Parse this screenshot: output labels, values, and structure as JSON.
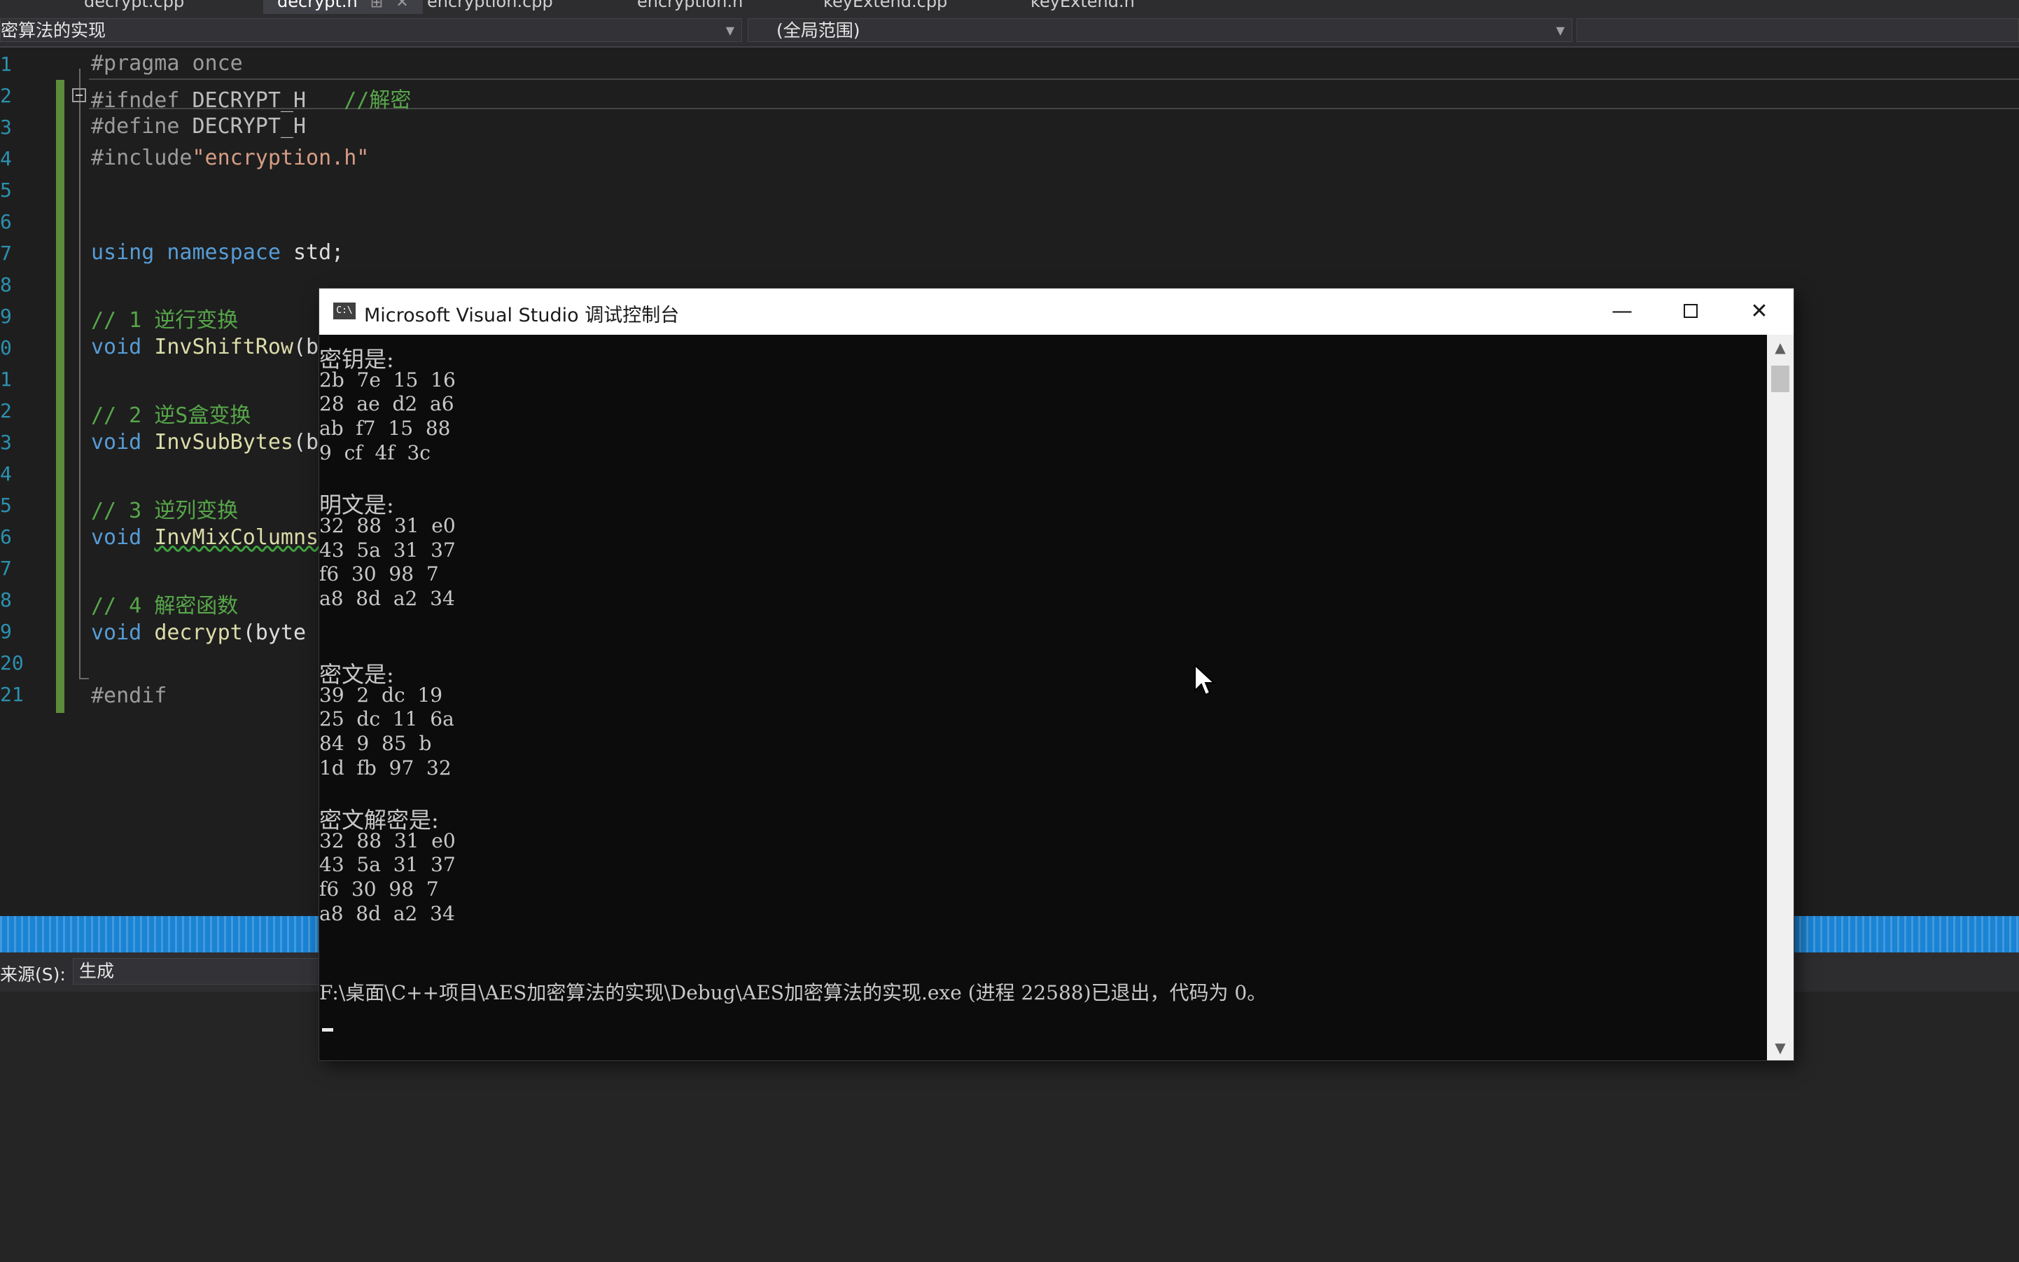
{
  "tabs": [
    {
      "label": "decrypt.cpp"
    },
    {
      "label": "decrypt.h",
      "active": true,
      "pin": "⊞",
      "close": "✕"
    },
    {
      "label": "encryption.cpp"
    },
    {
      "label": "encryption.h"
    },
    {
      "label": "keyExtend.cpp"
    },
    {
      "label": "keyExtend.h"
    }
  ],
  "navbar": {
    "project": "密算法的实现",
    "scope": "(全局范围)"
  },
  "editor": {
    "line_numbers": [
      "1",
      "2",
      "3",
      "4",
      "5",
      "6",
      "7",
      "8",
      "9",
      "0",
      "1",
      "2",
      "3",
      "4",
      "5",
      "6",
      "7",
      "8",
      "9",
      "20",
      "21"
    ],
    "lines": {
      "l1": "#pragma once",
      "l2_pp": "#ifndef",
      "l2_macro": "DECRYPT_H",
      "l2_comment": "//解密",
      "l3_pp": "#define",
      "l3_macro": "DECRYPT_H",
      "l4_pp": "#include",
      "l4_str": "\"encryption.h\"",
      "l7_kw1": "using",
      "l7_kw2": "namespace",
      "l7_rest": "std;",
      "l9": "// 1 逆行变换",
      "l10_kw": "void",
      "l10_fn": "InvShiftRow",
      "l10_rest": "(b",
      "l12": "// 2 逆S盒变换",
      "l13_kw": "void",
      "l13_fn": "InvSubBytes",
      "l13_rest": "(b",
      "l15": "// 3 逆列变换",
      "l16_kw": "void",
      "l16_fn": "InvMixColumns",
      "l18": "// 4 解密函数",
      "l19_kw": "void",
      "l19_fn": "decrypt",
      "l19_rest": "(byte",
      "l21": "#endif"
    }
  },
  "output": {
    "source_label": "来源(S):",
    "source_value": "生成"
  },
  "console": {
    "icon": "C:\\",
    "title": "Microsoft Visual Studio 调试控制台",
    "minimize": "—",
    "close": "✕",
    "lines": [
      "密钥是:",
      "2b  7e  15  16",
      "28  ae  d2  a6",
      "ab  f7  15  88",
      "9  cf  4f  3c",
      "明文是:",
      "32  88  31  e0",
      "43  5a  31  37",
      "f6  30  98  7",
      "a8  8d  a2  34",
      "密文是:",
      "39  2  dc  19",
      "25  dc  11  6a",
      "84  9  85  b",
      "1d  fb  97  32",
      "密文解密是:",
      "32  88  31  e0",
      "43  5a  31  37",
      "f6  30  98  7",
      "a8  8d  a2  34",
      "F:\\桌面\\C++项目\\AES加密算法的实现\\Debug\\AES加密算法的实现.exe (进程 22588)已退出，代码为 0。"
    ],
    "scroll_up": "▲",
    "scroll_down": "▼"
  },
  "colors": {
    "editor_bg": "#1e1e1e",
    "console_bg": "#0c0c0c",
    "status_blue": "#1a83d4",
    "keyword": "#569cd6",
    "comment": "#57a64a",
    "function": "#dcdcaa",
    "string": "#d69d85"
  },
  "icons": [
    "fold-collapse-icon",
    "console-app-icon",
    "minimize-icon",
    "maximize-icon",
    "close-icon",
    "scroll-up-icon",
    "scroll-down-icon",
    "mouse-pointer-icon"
  ]
}
